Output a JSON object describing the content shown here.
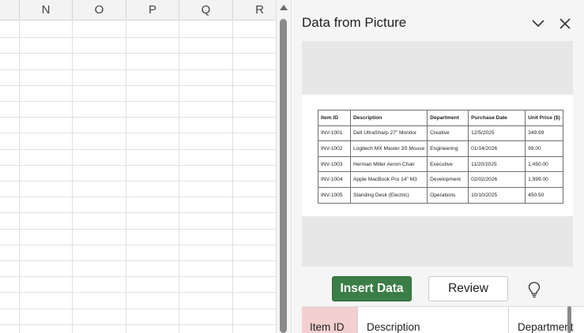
{
  "sheet": {
    "columns": [
      "N",
      "O",
      "P",
      "Q",
      "R"
    ]
  },
  "pane": {
    "title": "Data from Picture",
    "icons": {
      "collapse": "chevron-down-icon",
      "close": "close-icon",
      "suggest": "lightbulb-icon",
      "scroll_up": "arrow-up-icon"
    },
    "picture_table": {
      "headers": [
        "Item ID",
        "Description",
        "Department",
        "Purchase Date",
        "Unit Price ($)"
      ],
      "rows": [
        [
          "INV-1001",
          "Dell UltraSharp 27\" Monitor",
          "Creative",
          "12/5/2025",
          "349.99"
        ],
        [
          "INV-1002",
          "Logitech MX Master 3S Mouse",
          "Engineering",
          "01/14/2026",
          "99.00"
        ],
        [
          "INV-1003",
          "Herman Miller Aeron Chair",
          "Executive",
          "11/20/2025",
          "1,450.00"
        ],
        [
          "INV-1004",
          "Apple MacBook Pro 14\" M3",
          "Development",
          "02/02/2026",
          "1,999.00"
        ],
        [
          "INV-1005",
          "Standing Desk (Electric)",
          "Operations",
          "10/10/2025",
          "450.50"
        ]
      ]
    },
    "insert_label": "Insert Data",
    "review_label": "Review",
    "result_headers": [
      "Item ID",
      "Description",
      "Department"
    ]
  }
}
